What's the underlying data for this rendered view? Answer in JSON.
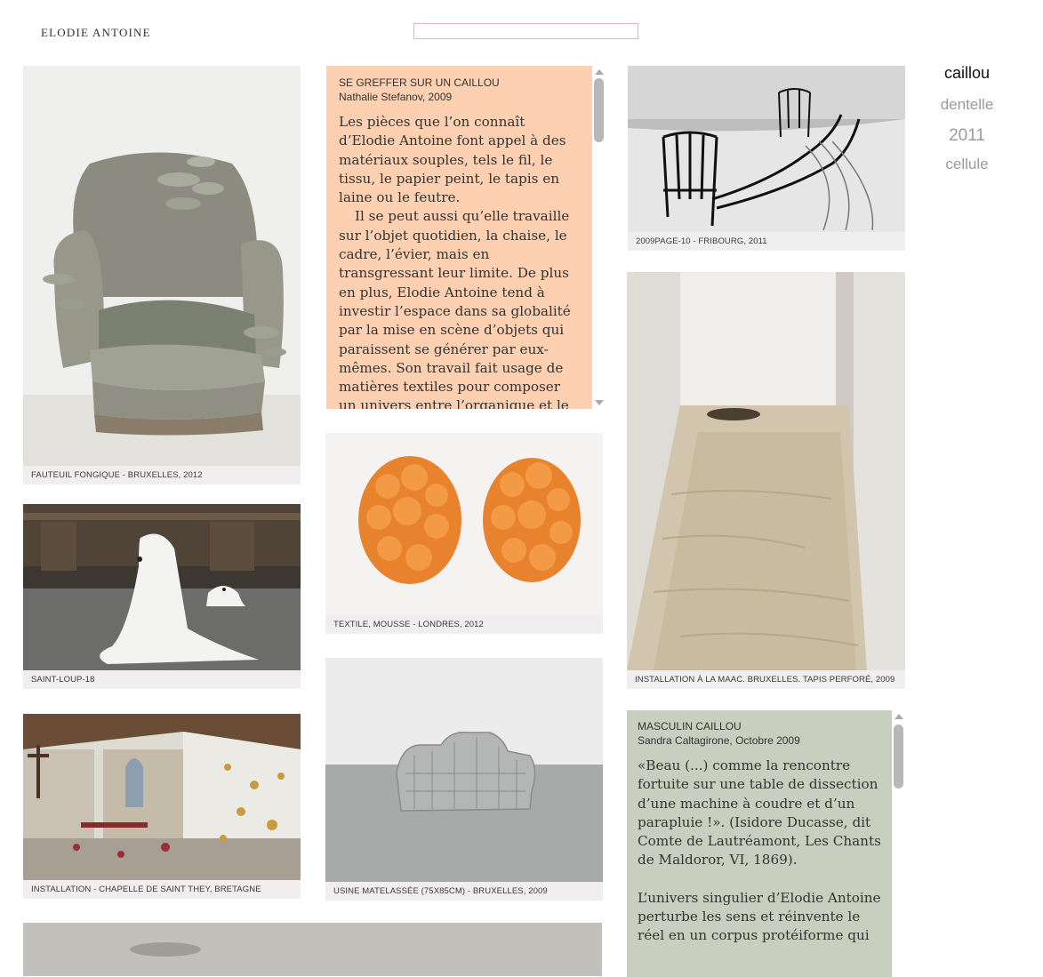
{
  "header": {
    "site_title": "ELODIE  ANTOINE",
    "search_value": ""
  },
  "nav": {
    "items": [
      "caillou",
      "dentelle",
      "2011",
      "cellule"
    ]
  },
  "captions": {
    "fauteuil": "FAUTEUIL FONGIQUE - BRUXELLES, 2012",
    "saint_loup": "SAINT-LOUP-18",
    "chapelle": "INSTALLATION - CHAPELLE DE SAINT THEY, BRETAGNE",
    "textile": "TEXTILE, MOUSSE - LONDRES, 2012",
    "usine": "USINE MATELASSÉE (75X85CM) - BRUXELLES, 2009",
    "chairs": "2009PAGE-10 - FRIBOURG, 2011",
    "maac": "INSTALLATION À LA MAAC. BRUXELLES. TAPIS PERFORÉ, 2009"
  },
  "text1": {
    "title": "SE GREFFER SUR UN CAILLOU",
    "author": "Nathalie Stefanov, 2009",
    "p1": "Les pièces que l’on connaît d’Elodie Antoine font appel à des matériaux souples, tels le fil, le tissu, le papier peint, le tapis en laine ou le feutre.",
    "p2": "Il se peut aussi qu’elle travaille sur l’objet quotidien, la chaise, le cadre, l’évier, mais en transgressant leur limite. De plus en plus, Elodie Antoine tend à investir l’espace dans sa globalité par la mise en scène d’objets qui paraissent se générer par eux-mêmes. Son travail fait usage de matières textiles pour composer un univers entre l’organique et le végétal où",
    "bg": "#fdd0b1"
  },
  "text2": {
    "title": "MASCULIN CAILLOU",
    "author": "Sandra Caltagirone, Octobre 2009",
    "p1": "«Beau (...) comme la rencontre fortuite sur une table de dissection d’une machine à coudre et d’un parapluie !». (Isidore Ducasse, dit Comte de Lautréamont, Les Chants de Maldoror, VI, 1869).",
    "p2": "L’univers singulier d’Elodie Antoine perturbe les sens et réinvente le réel en un corpus protéiforme qui",
    "bg": "#c9cfbf"
  }
}
